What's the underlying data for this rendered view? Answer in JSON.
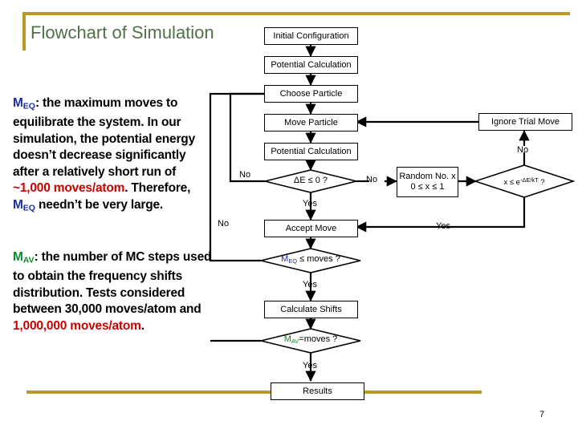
{
  "slide": {
    "title": "Flowchart of Simulation",
    "page_number": "7",
    "accent_gold": "#b79a21",
    "title_color": "#51704a",
    "blue": "#1c2ea0",
    "green": "#0a8a29",
    "red": "#cc0000"
  },
  "paragraphs": {
    "p1": {
      "term": "M",
      "term_sub": "EQ",
      "text_a": ": the maximum moves to equilibrate the system. In our simulation, the potential energy doesn’t decrease significantly after a relatively short run of ",
      "highlight_a": "~1,000 moves/atom",
      "text_b": ". Therefore, ",
      "term2": "M",
      "term2_sub": "EQ",
      "text_c": " needn’t be very large."
    },
    "p2": {
      "term": "M",
      "term_sub": "AV",
      "text_a": ": the number of MC steps used to obtain the frequency shifts distribution. Tests considered between 30,000 moves/atom and ",
      "highlight_a": "1,000,000 moves/atom",
      "text_b": "."
    }
  },
  "flowchart": {
    "boxes": [
      {
        "id": "initial_configuration",
        "label": "Initial Configuration"
      },
      {
        "id": "potential_calculation_1",
        "label": "Potential Calculation"
      },
      {
        "id": "choose_particle",
        "label": "Choose Particle"
      },
      {
        "id": "move_particle",
        "label": "Move Particle"
      },
      {
        "id": "potential_calculation_2",
        "label": "Potential Calculation"
      },
      {
        "id": "accept_move",
        "label": "Accept Move"
      },
      {
        "id": "calculate_shifts",
        "label": "Calculate Shifts"
      },
      {
        "id": "results",
        "label": "Results"
      },
      {
        "id": "ignore_trial_move",
        "label": "Ignore Trial Move"
      }
    ],
    "random_box": {
      "line1": "Random No. x",
      "line2": "0 ≤ x ≤ 1"
    },
    "decisions": [
      {
        "id": "delta_e",
        "label": "ΔE ≤ 0 ?"
      },
      {
        "id": "meq_moves",
        "label_prefix": "M",
        "label_sub": "EQ",
        "label_suffix": " ≤ moves ?"
      },
      {
        "id": "boltzmann",
        "label": "x ≤ e",
        "label_exp": "-ΔE/kT",
        "label_tail": " ?"
      },
      {
        "id": "mav_moves",
        "label_prefix": "M",
        "label_sub": "AV",
        "label_suffix": "=moves ?"
      }
    ],
    "edge_labels": [
      {
        "id": "no-left-outer",
        "text": "No"
      },
      {
        "id": "no-left-inner",
        "text": "No"
      },
      {
        "id": "no-delta-e",
        "text": "No"
      },
      {
        "id": "yes-delta-e",
        "text": "Yes"
      },
      {
        "id": "yes-meq",
        "text": "Yes"
      },
      {
        "id": "yes-mav",
        "text": "Yes"
      },
      {
        "id": "no-boltzmann",
        "text": "No"
      },
      {
        "id": "yes-boltzmann",
        "text": "Yes"
      }
    ]
  }
}
